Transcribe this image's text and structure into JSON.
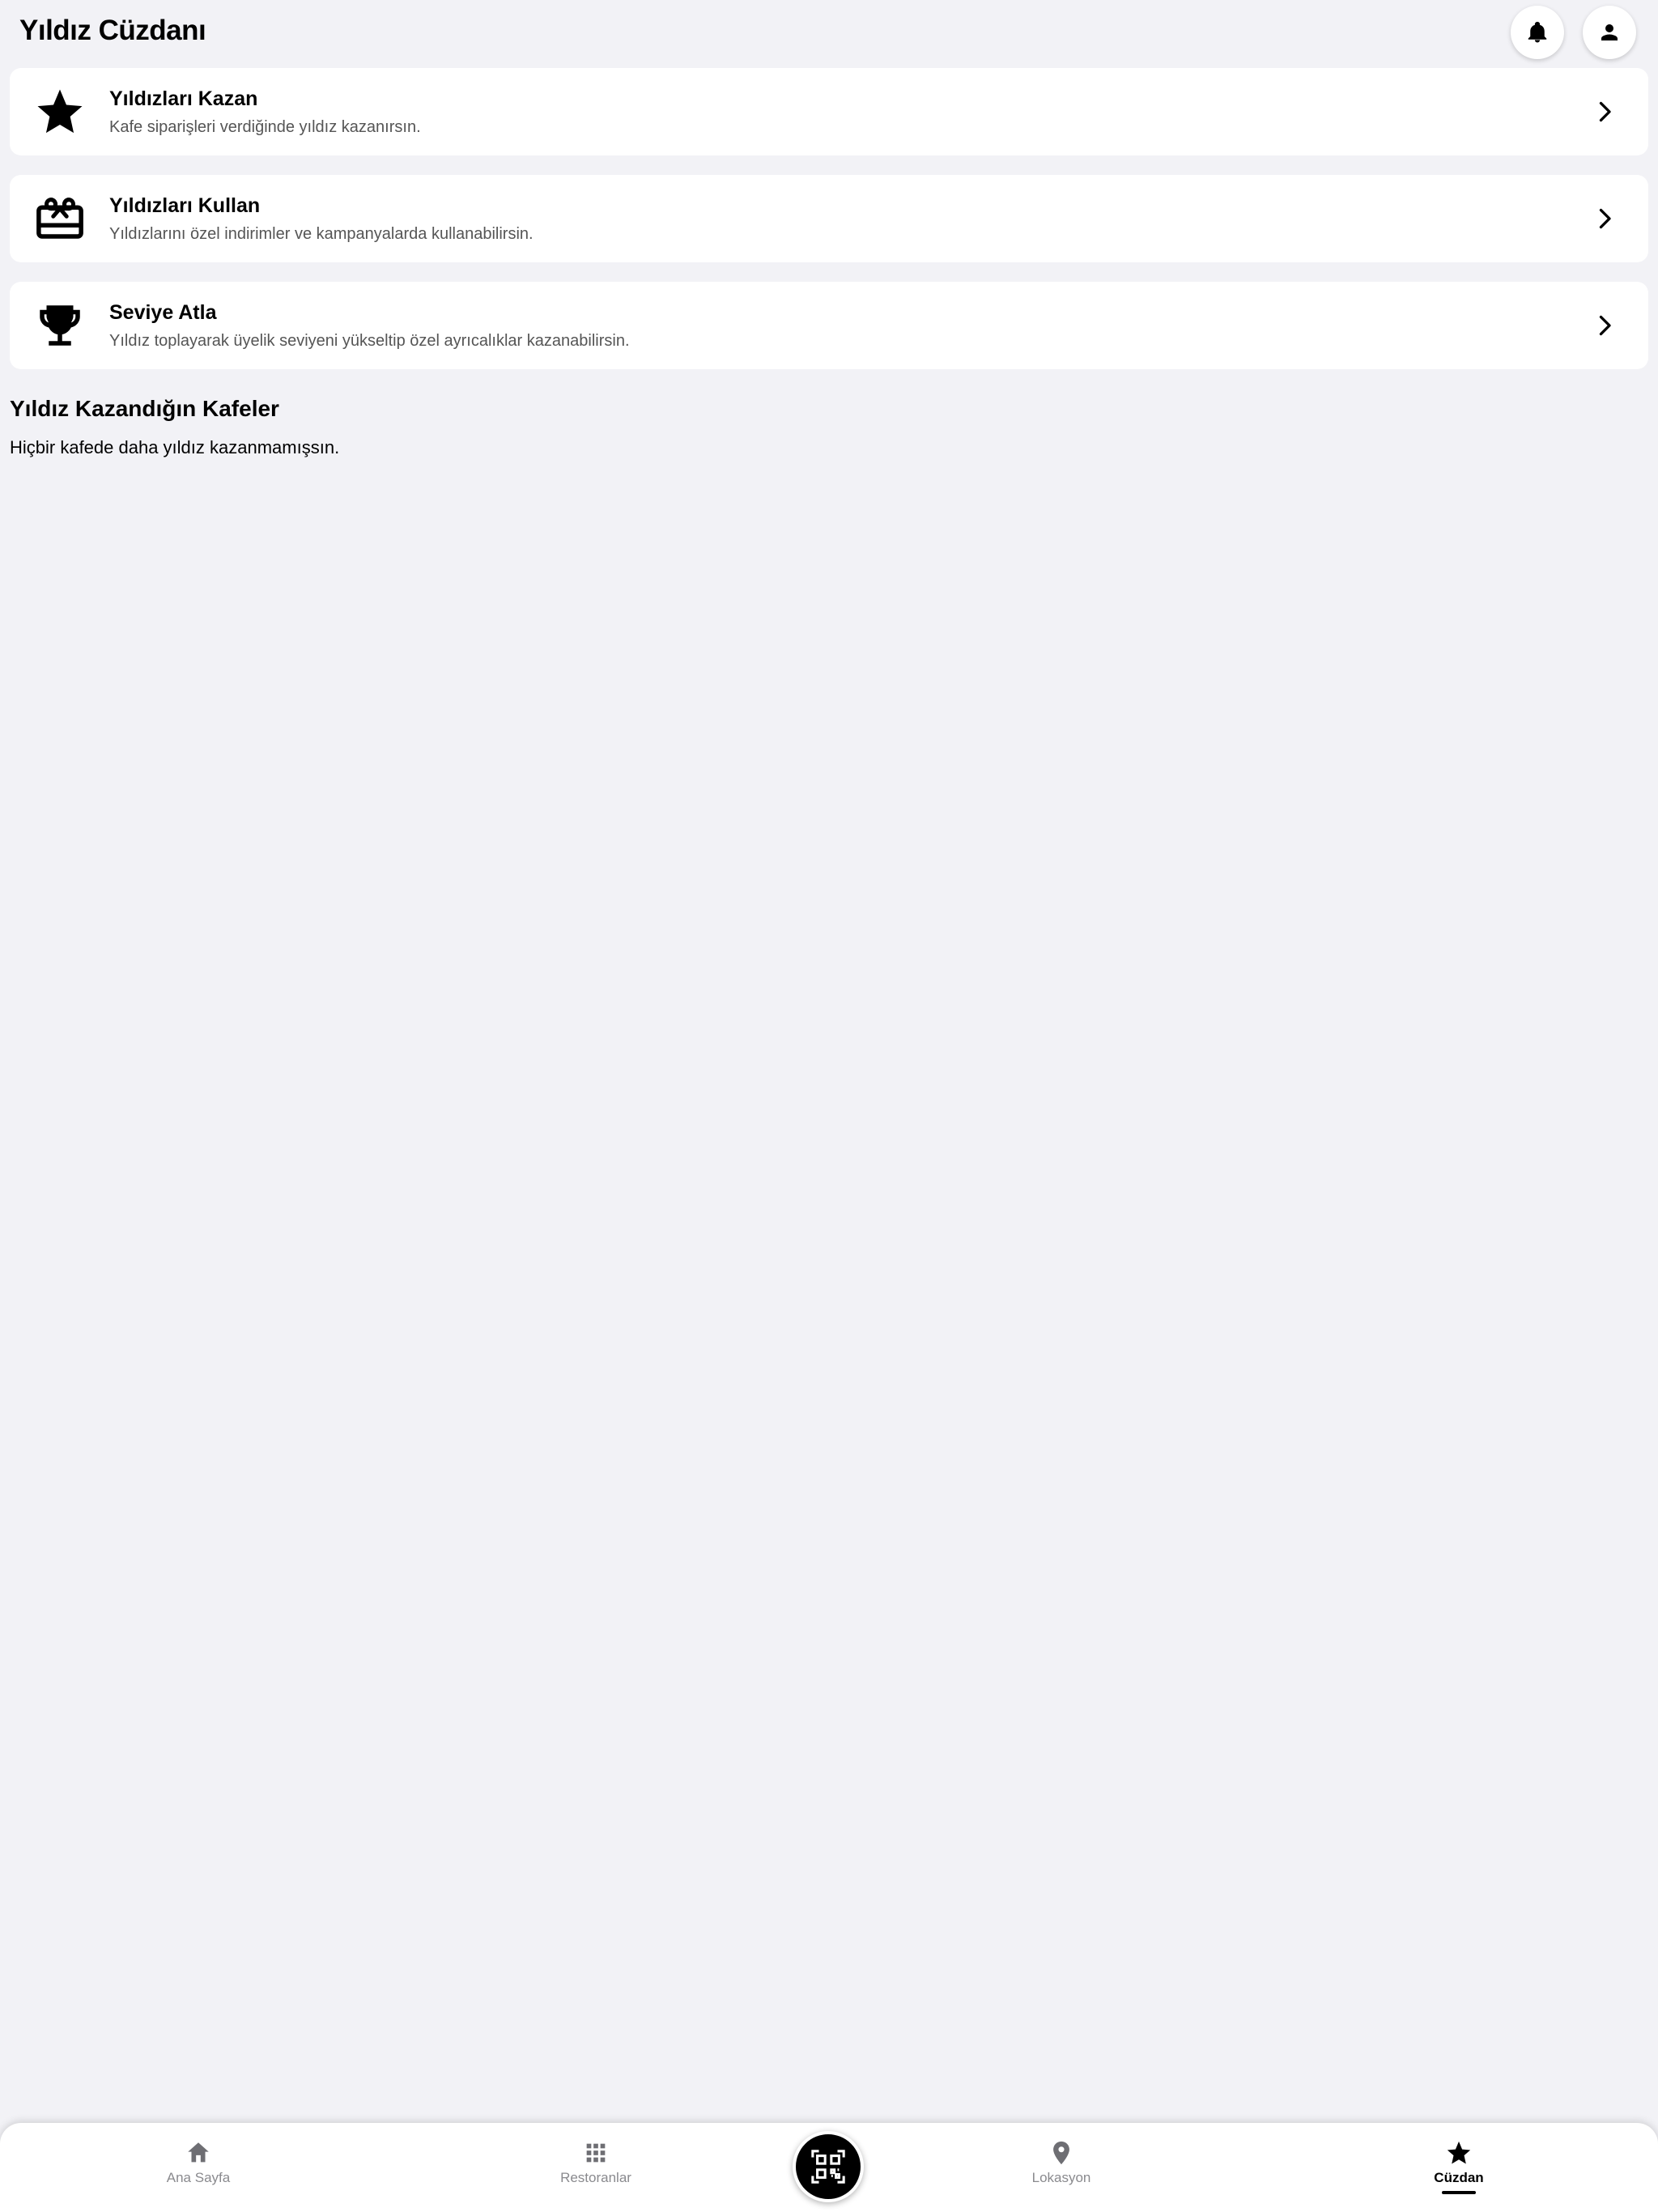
{
  "header": {
    "title": "Yıldız Cüzdanı",
    "notifications_icon": "bell-icon",
    "profile_icon": "person-icon"
  },
  "cards": [
    {
      "icon": "star-icon",
      "title": "Yıldızları Kazan",
      "description": "Kafe siparişleri verdiğinde yıldız kazanırsın."
    },
    {
      "icon": "gift-card-icon",
      "title": "Yıldızları Kullan",
      "description": "Yıldızlarını özel indirimler ve kampanyalarda kullanabilirsin."
    },
    {
      "icon": "trophy-icon",
      "title": "Seviye Atla",
      "description": "Yıldız toplayarak üyelik seviyeni yükseltip özel ayrıcalıklar kazanabilirsin."
    }
  ],
  "cafes_section": {
    "title": "Yıldız Kazandığın Kafeler",
    "empty_message": "Hiçbir kafede daha yıldız kazanmamışsın."
  },
  "tabbar": {
    "tabs": [
      {
        "label": "Ana Sayfa",
        "icon": "home-icon",
        "active": false
      },
      {
        "label": "Restoranlar",
        "icon": "grid-icon",
        "active": false
      },
      {
        "label": "Lokasyon",
        "icon": "location-pin-icon",
        "active": false
      },
      {
        "label": "Cüzdan",
        "icon": "star-icon",
        "active": true
      }
    ],
    "center_button_icon": "qr-scan-icon"
  },
  "colors": {
    "background": "#f2f2f6",
    "card": "#ffffff",
    "text_primary": "#000000",
    "text_secondary": "#555555",
    "tab_inactive": "#8a8a8e"
  }
}
